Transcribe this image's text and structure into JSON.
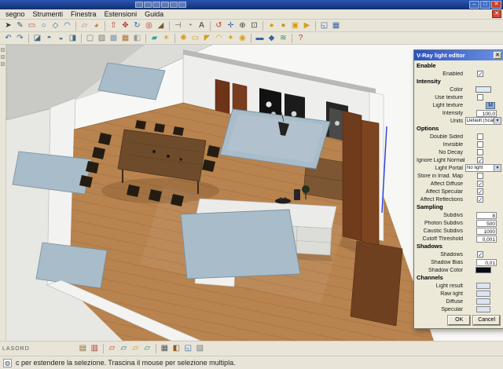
{
  "window": {
    "controls": {
      "minimize": "–",
      "maximize": "□",
      "close": "✕"
    },
    "child_close": "✕"
  },
  "menu": {
    "items": [
      "segno",
      "Strumenti",
      "Finestra",
      "Estensioni",
      "Guida"
    ]
  },
  "colors": {
    "accent_blue": "#2a52c0",
    "toolbar_bg": "#e8e5d8",
    "dialog_bg": "#ece9d8",
    "floor_wood": "#b8834e",
    "glass_panel": "#a9bcc9"
  },
  "toolbars": {
    "bottom_label": "LASORD",
    "row1": [
      {
        "name": "select-tool-icon",
        "glyph": "➤",
        "color": "#333333"
      },
      {
        "name": "line-tool-icon",
        "glyph": "✎",
        "color": "#555555"
      },
      {
        "name": "rectangle-tool-icon",
        "glyph": "▭",
        "color": "#b04a3a"
      },
      {
        "name": "circle-tool-icon",
        "glyph": "○",
        "color": "#3465a4"
      },
      {
        "name": "polygon-tool-icon",
        "glyph": "◇",
        "color": "#3465a4"
      },
      {
        "name": "arc-tool-icon",
        "glyph": "◠",
        "color": "#3465a4"
      },
      {
        "sep": true
      },
      {
        "name": "eraser-tool-icon",
        "glyph": "▱",
        "color": "#c07a8a"
      },
      {
        "name": "paint-bucket-tool-icon",
        "glyph": "◕",
        "color": "#c07a2a"
      },
      {
        "sep": true
      },
      {
        "name": "push-pull-tool-icon",
        "glyph": "⇧",
        "color": "#b03a2e"
      },
      {
        "name": "move-tool-icon",
        "glyph": "✥",
        "color": "#b03a2e"
      },
      {
        "name": "rotate-tool-icon",
        "glyph": "↻",
        "color": "#3465a4"
      },
      {
        "name": "offset-tool-icon",
        "glyph": "◎",
        "color": "#b03a2e"
      },
      {
        "name": "scale-tool-icon",
        "glyph": "◢",
        "color": "#7a5a2e"
      },
      {
        "sep": true
      },
      {
        "name": "tape-measure-tool-icon",
        "glyph": "⊣",
        "color": "#666666"
      },
      {
        "name": "protractor-tool-icon",
        "glyph": "◔",
        "color": "#666666"
      },
      {
        "name": "text-tool-icon",
        "glyph": "A",
        "color": "#333333"
      },
      {
        "sep": true
      },
      {
        "name": "orbit-tool-icon",
        "glyph": "↺",
        "color": "#c0392b"
      },
      {
        "name": "pan-tool-icon",
        "glyph": "✛",
        "color": "#3465a4"
      },
      {
        "name": "zoom-tool-icon",
        "glyph": "⊕",
        "color": "#444444"
      },
      {
        "name": "zoom-extents-tool-icon",
        "glyph": "⊡",
        "color": "#444444"
      },
      {
        "sep": true
      },
      {
        "name": "vray-material-editor-icon",
        "glyph": "●",
        "color": "#d4a017"
      },
      {
        "name": "vray-options-icon",
        "glyph": "●",
        "color": "#c9962a"
      },
      {
        "name": "vray-render-icon",
        "glyph": "▣",
        "color": "#d4a017"
      },
      {
        "name": "vray-rt-render-icon",
        "glyph": "▶",
        "color": "#d4a017"
      },
      {
        "sep": true
      },
      {
        "name": "component-icon",
        "glyph": "◱",
        "color": "#3465a4"
      },
      {
        "name": "group-icon",
        "glyph": "▦",
        "color": "#3465a4"
      }
    ],
    "row2": [
      {
        "name": "previous-view-icon",
        "glyph": "↶",
        "color": "#3465a4"
      },
      {
        "name": "next-view-icon",
        "glyph": "↷",
        "color": "#3465a4"
      },
      {
        "sep": true
      },
      {
        "name": "iso-view-icon",
        "glyph": "◪",
        "color": "#44687d"
      },
      {
        "name": "top-view-icon",
        "glyph": "◓",
        "color": "#44687d"
      },
      {
        "name": "front-view-icon",
        "glyph": "◒",
        "color": "#44687d"
      },
      {
        "name": "side-view-icon",
        "glyph": "◨",
        "color": "#44687d"
      },
      {
        "sep": true
      },
      {
        "name": "wireframe-style-icon",
        "glyph": "▢",
        "color": "#777777"
      },
      {
        "name": "hidden-line-style-icon",
        "glyph": "▧",
        "color": "#777777"
      },
      {
        "name": "shaded-style-icon",
        "glyph": "▩",
        "color": "#7d98a8"
      },
      {
        "name": "textured-style-icon",
        "glyph": "▦",
        "color": "#a8743a"
      },
      {
        "name": "monochrome-style-icon",
        "glyph": "◧",
        "color": "#999999"
      },
      {
        "sep": true
      },
      {
        "name": "section-plane-icon",
        "glyph": "▰",
        "color": "#3aa0a0"
      },
      {
        "name": "shadows-toggle-icon",
        "glyph": "☀",
        "color": "#d89c2a"
      },
      {
        "sep": true
      },
      {
        "name": "vray-omni-light-icon",
        "glyph": "✺",
        "color": "#d4a017"
      },
      {
        "name": "vray-rectangle-light-icon",
        "glyph": "▭",
        "color": "#d4a017"
      },
      {
        "name": "vray-spot-light-icon",
        "glyph": "◤",
        "color": "#d4a017"
      },
      {
        "name": "vray-dome-light-icon",
        "glyph": "◠",
        "color": "#d4a017"
      },
      {
        "name": "vray-ies-light-icon",
        "glyph": "✦",
        "color": "#d4a017"
      },
      {
        "name": "vray-sphere-light-icon",
        "glyph": "◉",
        "color": "#d4a017"
      },
      {
        "sep": true
      },
      {
        "name": "vray-infinite-plane-icon",
        "glyph": "▬",
        "color": "#3465a4"
      },
      {
        "name": "vray-proxy-icon",
        "glyph": "◆",
        "color": "#3465a4"
      },
      {
        "name": "vray-fur-icon",
        "glyph": "≋",
        "color": "#2e8b57"
      },
      {
        "sep": true
      },
      {
        "name": "help-icon",
        "glyph": "?",
        "color": "#b03a2e"
      }
    ],
    "bottom": [
      {
        "name": "vray-frame-buffer-icon",
        "glyph": "▤",
        "color": "#8a6b3a"
      },
      {
        "name": "vray-batch-render-icon",
        "glyph": "▥",
        "color": "#b03a2e"
      },
      {
        "sep": true
      },
      {
        "name": "page-red-icon",
        "glyph": "▱",
        "color": "#c0392b"
      },
      {
        "name": "page-blue-icon",
        "glyph": "▱",
        "color": "#3465a4"
      },
      {
        "name": "page-yellow-icon",
        "glyph": "▱",
        "color": "#d4a017"
      },
      {
        "name": "page-green-icon",
        "glyph": "▱",
        "color": "#2e8b57"
      },
      {
        "sep": true
      },
      {
        "name": "layers-panel-icon",
        "glyph": "▦",
        "color": "#555555"
      },
      {
        "name": "materials-panel-icon",
        "glyph": "◧",
        "color": "#8a5a2a"
      },
      {
        "name": "components-panel-icon",
        "glyph": "◱",
        "color": "#3465a4"
      },
      {
        "name": "styles-panel-icon",
        "glyph": "▨",
        "color": "#777777"
      }
    ]
  },
  "dialog": {
    "title": "V-Ray light editor",
    "close_glyph": "✕",
    "buttons": {
      "ok": "OK",
      "cancel": "Cancel"
    },
    "sections": [
      {
        "title": "Enable",
        "rows": [
          {
            "name": "enabled",
            "label": "Enabled",
            "type": "checkbox",
            "checked": true
          }
        ]
      },
      {
        "title": "Intensity",
        "rows": [
          {
            "name": "color",
            "label": "Color",
            "type": "color",
            "value": "#dcebf8"
          },
          {
            "name": "use-texture",
            "label": "Use texture",
            "type": "checkbox",
            "checked": false
          },
          {
            "name": "light-texture",
            "label": "Light texture",
            "type": "mbutton",
            "value": "M"
          },
          {
            "name": "intensity",
            "label": "Intensity",
            "type": "text",
            "value": "100,0"
          },
          {
            "name": "units",
            "label": "Units",
            "type": "dropdown",
            "value": "Default (Scalar)"
          }
        ]
      },
      {
        "title": "Options",
        "rows": [
          {
            "name": "double-sided",
            "label": "Double Sided",
            "type": "checkbox",
            "checked": false
          },
          {
            "name": "invisible",
            "label": "Invisible",
            "type": "checkbox",
            "checked": false
          },
          {
            "name": "no-decay",
            "label": "No Decay",
            "type": "checkbox",
            "checked": false
          },
          {
            "name": "ignore-light-normals",
            "label": "Ignore Light Normals",
            "type": "checkbox",
            "checked": true
          },
          {
            "name": "light-portal",
            "label": "Light Portal",
            "type": "dropdown",
            "value": "No light"
          },
          {
            "name": "store-in-irrad-map",
            "label": "Store in Irrad. Map",
            "type": "checkbox",
            "checked": false
          },
          {
            "name": "affect-diffuse",
            "label": "Affect Diffuse",
            "type": "checkbox",
            "checked": true
          },
          {
            "name": "affect-specular",
            "label": "Affect Specular",
            "type": "checkbox",
            "checked": true
          },
          {
            "name": "affect-reflections",
            "label": "Affect Reflections",
            "type": "checkbox",
            "checked": true
          }
        ]
      },
      {
        "title": "Sampling",
        "rows": [
          {
            "name": "subdivs",
            "label": "Subdivs",
            "type": "text",
            "value": "8"
          },
          {
            "name": "photon-subdivs",
            "label": "Photon Subdivs",
            "type": "text",
            "value": "500"
          },
          {
            "name": "caustic-subdivs",
            "label": "Caustic Subdivs",
            "type": "text",
            "value": "1000"
          },
          {
            "name": "cutoff-threshold",
            "label": "Cutoff Threshold",
            "type": "text",
            "value": "0,001"
          }
        ]
      },
      {
        "title": "Shadows",
        "rows": [
          {
            "name": "shadows",
            "label": "Shadows",
            "type": "checkbox",
            "checked": true
          },
          {
            "name": "shadow-bias",
            "label": "Shadow Bias",
            "type": "text",
            "value": "0,01"
          },
          {
            "name": "shadow-color",
            "label": "Shadow Color",
            "type": "color",
            "value": "#070c16"
          }
        ]
      },
      {
        "title": "Channels",
        "rows": [
          {
            "name": "light-result",
            "label": "Light result",
            "type": "chan"
          },
          {
            "name": "raw-light",
            "label": "Raw light",
            "type": "chan"
          },
          {
            "name": "diffuse",
            "label": "Diffuse",
            "type": "chan"
          },
          {
            "name": "specular",
            "label": "Specular",
            "type": "chan"
          }
        ]
      }
    ]
  },
  "statusbar": {
    "hint": "c per estendere la selezione. Trascina il mouse per selezione multipla."
  }
}
